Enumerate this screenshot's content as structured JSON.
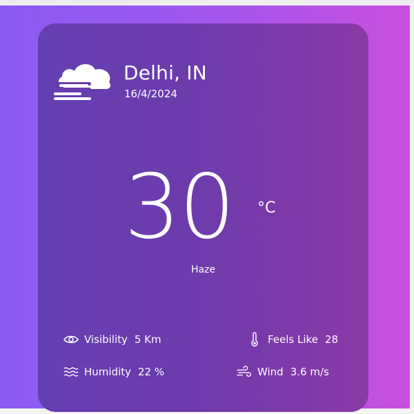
{
  "location": {
    "city": "Delhi, IN",
    "date": "16/4/2024"
  },
  "weather": {
    "icon": "cloud-haze-icon",
    "temperature": "30",
    "unit": "°C",
    "condition": "Haze"
  },
  "details": {
    "visibility": {
      "label": "Visibility",
      "value": "5 Km",
      "icon": "eye-icon"
    },
    "feels_like": {
      "label": "Feels Like",
      "value": "28",
      "icon": "thermometer-icon"
    },
    "humidity": {
      "label": "Humidity",
      "value": "22 %",
      "icon": "waves-icon"
    },
    "wind": {
      "label": "Wind",
      "value": "3.6 m/s",
      "icon": "wind-icon"
    }
  },
  "colors": {
    "background_left": "#8a5cf2",
    "background_right": "#c94fdd",
    "card_left": "#643fb1",
    "card_right": "#8a3aa7",
    "text": "#ffffff"
  }
}
